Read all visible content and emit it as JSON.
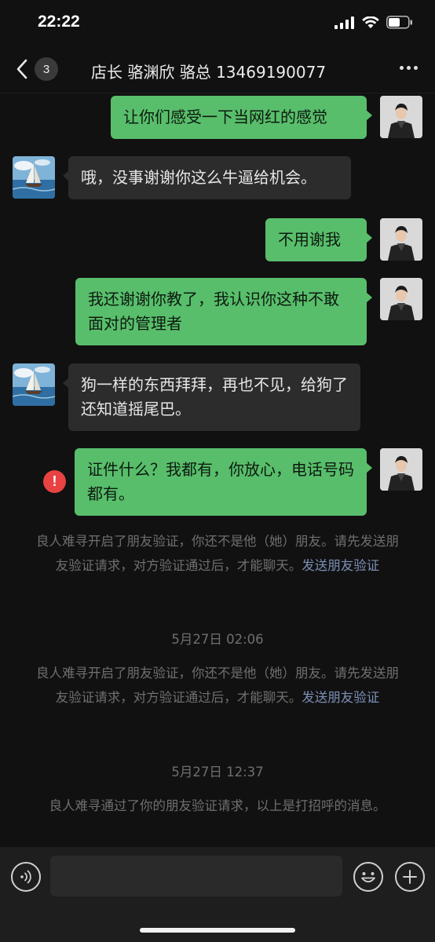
{
  "status_bar": {
    "time": "22:22",
    "icons": [
      "cellular-signal-icon",
      "wifi-icon",
      "battery-icon"
    ]
  },
  "header": {
    "back_badge": "3",
    "title": "店长 骆渊欣 骆总 13469190077",
    "more_icon": "more-dots-icon"
  },
  "messages": [
    {
      "side": "out",
      "text": "让你们感受一下当网红的感觉"
    },
    {
      "side": "in",
      "text": "哦，没事谢谢你这么牛逼给机会。"
    },
    {
      "side": "out",
      "text": "不用谢我"
    },
    {
      "side": "out",
      "text": "我还谢谢你教了，我认识你这种不敢面对的管理者"
    },
    {
      "side": "in",
      "text": "狗一样的东西拜拜，再也不见，给狗了还知道摇尾巴。"
    },
    {
      "side": "out",
      "text": "证件什么？我都有，你放心，电话号码都有。",
      "failed": true
    }
  ],
  "system": {
    "notice_1": "良人难寻开启了朋友验证，你还不是他（她）朋友。请先发送朋友验证请求，对方验证通过后，才能聊天。",
    "notice_1_link": "发送朋友验证",
    "time_1": "5月27日 02:06",
    "notice_2": "良人难寻开启了朋友验证，你还不是他（她）朋友。请先发送朋友验证请求，对方验证通过后，才能聊天。",
    "notice_2_link": "发送朋友验证",
    "time_2": "5月27日 12:37",
    "notice_3": "良人难寻通过了你的朋友验证请求，以上是打招呼的消息。"
  },
  "input_bar": {
    "placeholder": "",
    "icons": [
      "voice-icon",
      "emoji-icon",
      "plus-icon"
    ]
  },
  "colors": {
    "background": "#111111",
    "bubble_out": "#58be6b",
    "bubble_in": "#2c2c2c",
    "link": "#7d90b6",
    "error": "#e84242"
  }
}
